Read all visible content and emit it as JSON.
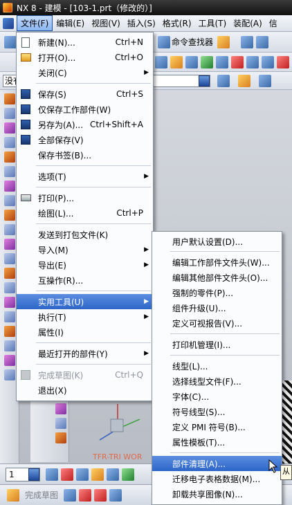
{
  "window": {
    "title": "NX 8 - 建模 - [103-1.prt（修改的）]"
  },
  "menubar": {
    "items": [
      {
        "label": "文件(F)"
      },
      {
        "label": "编辑(E)"
      },
      {
        "label": "视图(V)"
      },
      {
        "label": "插入(S)"
      },
      {
        "label": "格式(R)"
      },
      {
        "label": "工具(T)"
      },
      {
        "label": "装配(A)"
      },
      {
        "label": "信"
      }
    ]
  },
  "toolbar": {
    "command_finder_label": "命令查找器",
    "selection_filter_value": "没有"
  },
  "file_menu": {
    "items": [
      {
        "label": "新建(N)...",
        "shortcut": "Ctrl+N",
        "icon": "new-file-icon"
      },
      {
        "label": "打开(O)...",
        "shortcut": "Ctrl+O",
        "icon": "open-folder-icon"
      },
      {
        "label": "关闭(C)",
        "submenu": true
      },
      {
        "label": "保存(S)",
        "shortcut": "Ctrl+S",
        "icon": "save-icon"
      },
      {
        "label": "仅保存工作部件(W)",
        "icon": "save-work-part-icon"
      },
      {
        "label": "另存为(A)...",
        "shortcut": "Ctrl+Shift+A",
        "icon": "save-as-icon"
      },
      {
        "label": "全部保存(V)",
        "icon": "save-all-icon"
      },
      {
        "label": "保存书签(B)..."
      },
      {
        "label": "选项(T)",
        "submenu": true
      },
      {
        "label": "打印(P)...",
        "icon": "print-icon"
      },
      {
        "label": "绘图(L)...",
        "shortcut": "Ctrl+P"
      },
      {
        "label": "发送到打包文件(K)"
      },
      {
        "label": "导入(M)",
        "submenu": true
      },
      {
        "label": "导出(E)",
        "submenu": true
      },
      {
        "label": "互操作(R)..."
      },
      {
        "label": "实用工具(U)",
        "submenu": true,
        "highlighted": true
      },
      {
        "label": "执行(T)",
        "submenu": true
      },
      {
        "label": "属性(I)"
      },
      {
        "label": "最近打开的部件(Y)",
        "submenu": true
      },
      {
        "label": "完成草图(K)",
        "shortcut": "Ctrl+Q",
        "disabled": true,
        "icon": "finish-sketch-icon"
      },
      {
        "label": "退出(X)"
      }
    ]
  },
  "utilities_submenu": {
    "items": [
      {
        "label": "用户默认设置(D)..."
      },
      {
        "label": "编辑工作部件文件头(W)..."
      },
      {
        "label": "编辑其他部件文件头(O)..."
      },
      {
        "label": "强制的零件(P)..."
      },
      {
        "label": "组件升级(U)..."
      },
      {
        "label": "定义可视报告(V)..."
      },
      {
        "label": "打印机管理(I)..."
      },
      {
        "label": "线型(L)..."
      },
      {
        "label": "选择线型文件(F)..."
      },
      {
        "label": "字体(C)..."
      },
      {
        "label": "符号线型(S)..."
      },
      {
        "label": "定义 PMI 符号(B)..."
      },
      {
        "label": "属性模板(T)..."
      },
      {
        "label": "部件清理(A)...",
        "highlighted": true
      },
      {
        "label": "迁移电子表格数据(M)..."
      },
      {
        "label": "卸载共享图像(N)..."
      }
    ]
  },
  "graphics": {
    "triad_label": "TFR-TRI WOR"
  },
  "bottom_toolbar": {
    "layer_value": "1",
    "finish_sketch_label": "完成草图"
  },
  "tooltip": {
    "text": "从"
  },
  "colors": {
    "highlight": "#3a72d4",
    "menu_bg": "#fbfcfe",
    "title_bg": "#1a1a1a"
  }
}
